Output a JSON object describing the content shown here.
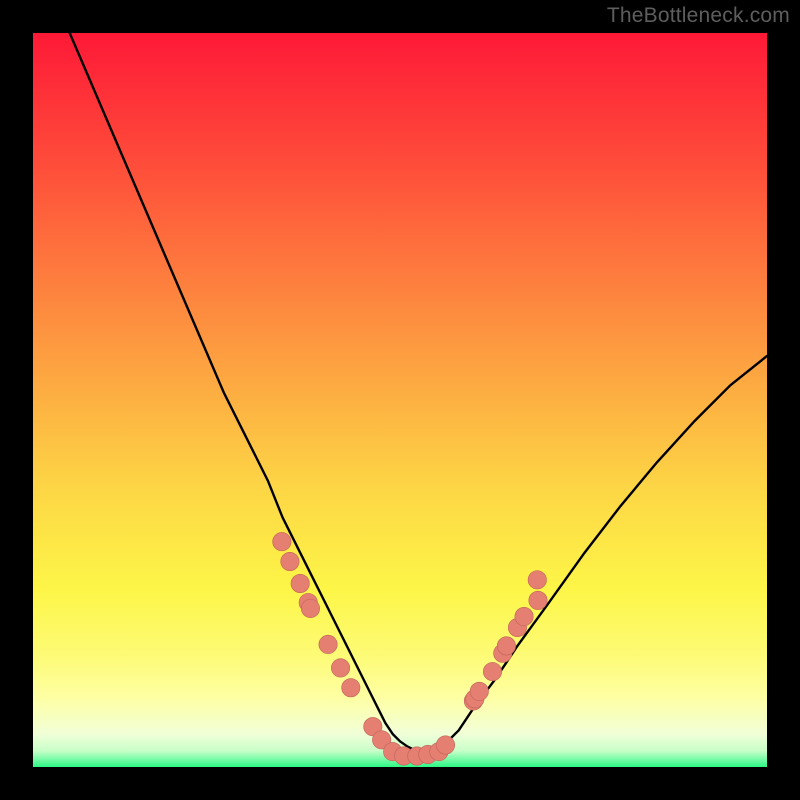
{
  "watermark": "TheBottleneck.com",
  "colors": {
    "frame_bg": "#000000",
    "gradient_top": "#fe1937",
    "gradient_upper": "#fe4d3a",
    "gradient_mid_high": "#fd9840",
    "gradient_mid": "#fdd645",
    "gradient_mid_low": "#fdf648",
    "gradient_pale": "#feffa3",
    "gradient_paler": "#f1ffd8",
    "gradient_bottom": "#2cf986",
    "curve_stroke": "#000000",
    "marker_fill": "#e47f72",
    "marker_stroke": "#c06358"
  },
  "chart_data": {
    "type": "line",
    "title": "",
    "xlabel": "",
    "ylabel": "",
    "xlim": [
      0,
      100
    ],
    "ylim": [
      0,
      100
    ],
    "series": [
      {
        "name": "bottleneck-curve",
        "x": [
          5,
          8,
          11,
          14,
          17,
          20,
          23,
          26,
          29,
          32,
          34,
          36,
          38,
          40,
          42,
          44,
          46,
          47,
          48,
          49,
          50,
          51,
          52,
          53,
          54,
          55,
          56,
          58,
          60,
          63,
          66,
          70,
          75,
          80,
          85,
          90,
          95,
          100
        ],
        "y": [
          100,
          93,
          86,
          79,
          72,
          65,
          58,
          51,
          45,
          39,
          34,
          30,
          26,
          22,
          18,
          14,
          10,
          8,
          6,
          4.5,
          3.5,
          2.8,
          2.3,
          2,
          2,
          2.2,
          3,
          5,
          8,
          12,
          16.5,
          22,
          29,
          35.5,
          41.5,
          47,
          52,
          56
        ]
      }
    ],
    "markers": [
      {
        "x": 33.9,
        "y": 30.7
      },
      {
        "x": 35.0,
        "y": 28.0
      },
      {
        "x": 36.4,
        "y": 25.0
      },
      {
        "x": 37.5,
        "y": 22.4
      },
      {
        "x": 37.8,
        "y": 21.6
      },
      {
        "x": 40.2,
        "y": 16.7
      },
      {
        "x": 41.9,
        "y": 13.5
      },
      {
        "x": 43.3,
        "y": 10.8
      },
      {
        "x": 46.3,
        "y": 5.5
      },
      {
        "x": 47.5,
        "y": 3.7
      },
      {
        "x": 49.0,
        "y": 2.1
      },
      {
        "x": 50.5,
        "y": 1.5
      },
      {
        "x": 52.3,
        "y": 1.5
      },
      {
        "x": 53.8,
        "y": 1.7
      },
      {
        "x": 55.3,
        "y": 2.1
      },
      {
        "x": 56.2,
        "y": 3.0
      },
      {
        "x": 60.0,
        "y": 9.0
      },
      {
        "x": 60.2,
        "y": 9.3
      },
      {
        "x": 60.8,
        "y": 10.3
      },
      {
        "x": 62.6,
        "y": 13.0
      },
      {
        "x": 64.0,
        "y": 15.5
      },
      {
        "x": 64.5,
        "y": 16.5
      },
      {
        "x": 66.0,
        "y": 19.0
      },
      {
        "x": 66.9,
        "y": 20.5
      },
      {
        "x": 68.8,
        "y": 22.7
      },
      {
        "x": 68.7,
        "y": 25.5
      }
    ]
  }
}
